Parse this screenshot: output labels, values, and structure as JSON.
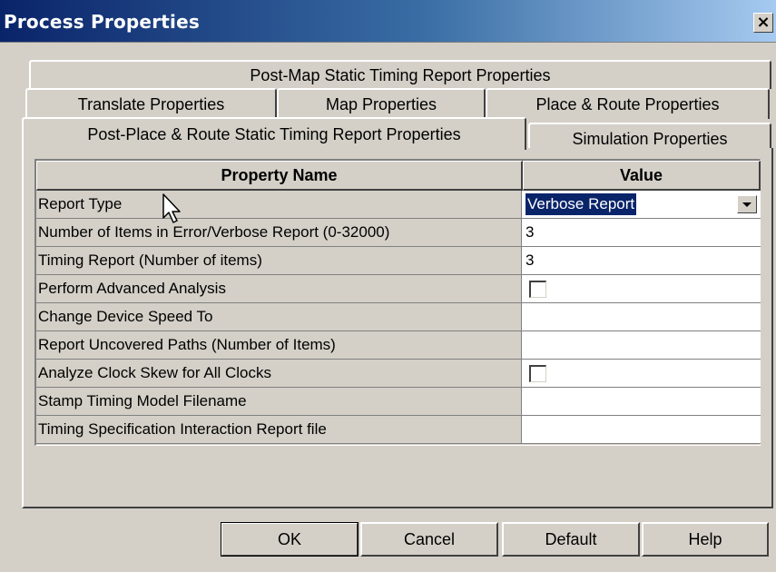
{
  "window": {
    "title": "Process Properties",
    "close_label": "×"
  },
  "tabs": {
    "row1": [
      "Post-Map Static Timing Report Properties"
    ],
    "row2": [
      "Translate Properties",
      "Map Properties",
      "Place & Route Properties"
    ],
    "row3": [
      "Post-Place & Route Static Timing Report Properties",
      "Simulation Properties"
    ],
    "active": "Post-Place & Route Static Timing Report Properties"
  },
  "grid": {
    "headers": {
      "name": "Property Name",
      "value": "Value"
    },
    "rows": [
      {
        "name": "Report Type",
        "value": "Verbose Report",
        "type": "combo"
      },
      {
        "name": "Number of Items in Error/Verbose Report (0-32000)",
        "value": "3",
        "type": "text"
      },
      {
        "name": "Timing Report (Number of items)",
        "value": "3",
        "type": "text"
      },
      {
        "name": "Perform Advanced Analysis",
        "value": "",
        "type": "checkbox",
        "checked": false
      },
      {
        "name": "Change Device Speed To",
        "value": "",
        "type": "text"
      },
      {
        "name": "Report Uncovered Paths (Number of Items)",
        "value": "",
        "type": "text"
      },
      {
        "name": "Analyze Clock Skew for All Clocks",
        "value": "",
        "type": "checkbox",
        "checked": false
      },
      {
        "name": "Stamp Timing Model Filename",
        "value": "",
        "type": "text"
      },
      {
        "name": "Timing Specification Interaction Report file",
        "value": "",
        "type": "text"
      }
    ]
  },
  "buttons": {
    "ok": "OK",
    "cancel": "Cancel",
    "default": "Default",
    "help": "Help"
  },
  "colors": {
    "titlebar_start": "#0a246a",
    "titlebar_end": "#a6caf0",
    "face": "#d4d0c8",
    "selection": "#0a246a"
  }
}
